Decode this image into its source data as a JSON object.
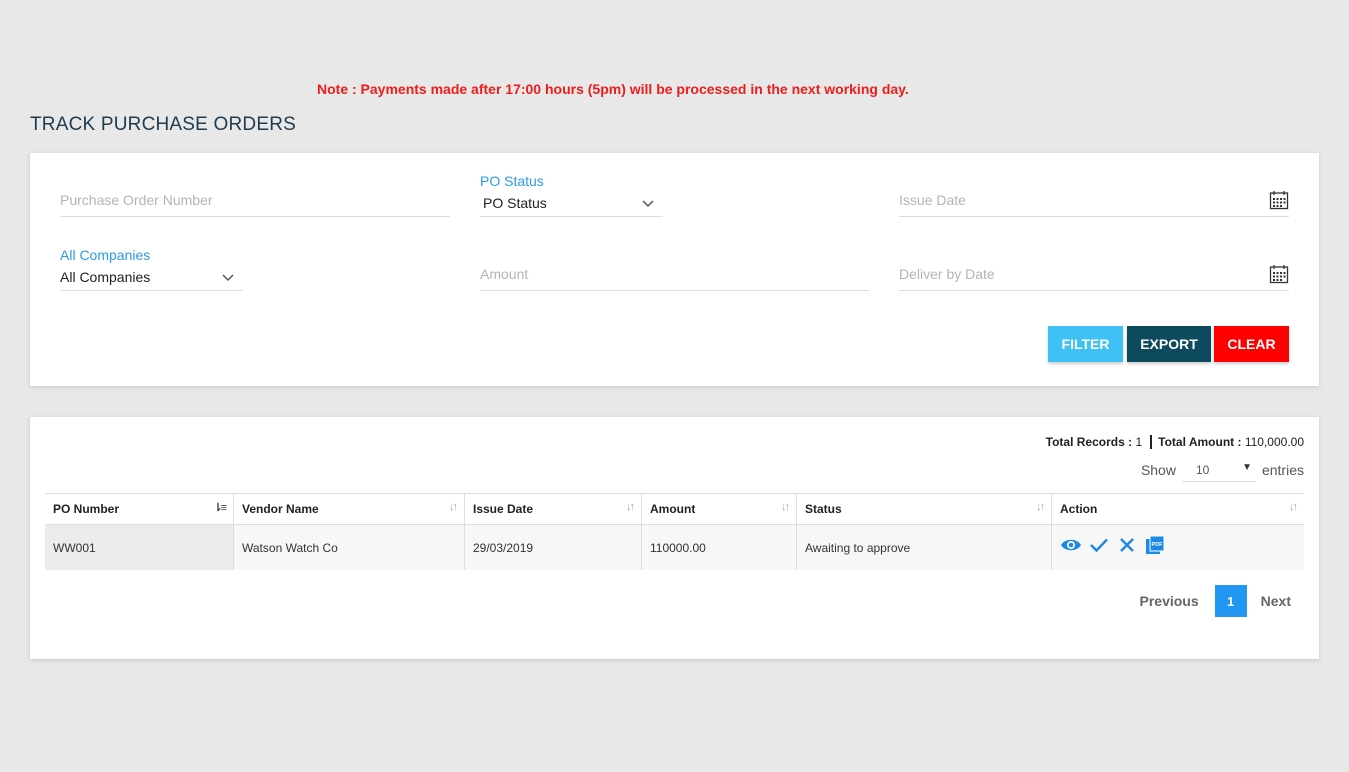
{
  "note": "Note : Payments made after 17:00 hours (5pm) will be processed in the next working day.",
  "page_title": "TRACK PURCHASE ORDERS",
  "filters": {
    "po_number_placeholder": "Purchase Order Number",
    "po_status_label": "PO Status",
    "po_status_value": "PO Status",
    "issue_date_placeholder": "Issue Date",
    "companies_label": "All Companies",
    "companies_value": "All Companies",
    "amount_placeholder": "Amount",
    "deliver_by_placeholder": "Deliver by Date"
  },
  "buttons": {
    "filter": "FILTER",
    "export": "EXPORT",
    "clear": "CLEAR"
  },
  "colors": {
    "note": "#ee1c1c",
    "accent": "#2a9be6",
    "filter_btn": "#3fc1f6",
    "export_btn": "#0d4a5e",
    "clear_btn": "#ff0000",
    "page_active": "#2196f3"
  },
  "summary": {
    "total_records_label": "Total Records :",
    "total_records_value": "1",
    "total_amount_label": "Total Amount :",
    "total_amount_value": "110,000.00"
  },
  "entries": {
    "show_label": "Show",
    "value": "10",
    "entries_label": "entries"
  },
  "table": {
    "headers": [
      "PO Number",
      "Vendor Name",
      "Issue Date",
      "Amount",
      "Status",
      "Action"
    ],
    "rows": [
      {
        "po_number": "WW001",
        "vendor_name": "Watson Watch Co",
        "issue_date": "29/03/2019",
        "amount": "110000.00",
        "status": "Awaiting to approve",
        "actions": [
          "eye-icon",
          "check-icon",
          "close-icon",
          "pdf-icon"
        ]
      }
    ]
  },
  "pagination": {
    "previous": "Previous",
    "current": "1",
    "next": "Next"
  }
}
